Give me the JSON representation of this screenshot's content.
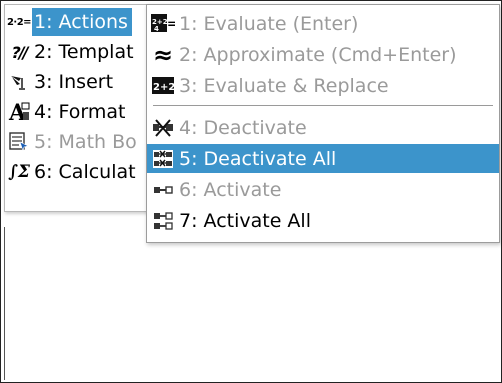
{
  "main_menu": {
    "items": [
      {
        "label": "1: Actions",
        "icon": "actions-icon",
        "state": "active"
      },
      {
        "label": "2: Templat",
        "icon": "templates-icon",
        "state": "normal"
      },
      {
        "label": "3: Insert",
        "icon": "insert-icon",
        "state": "normal"
      },
      {
        "label": "4: Format",
        "icon": "format-icon",
        "state": "normal"
      },
      {
        "label": "5: Math Bo",
        "icon": "math-boxes-icon",
        "state": "disabled"
      },
      {
        "label": "6: Calculat",
        "icon": "calculus-icon",
        "state": "normal"
      }
    ]
  },
  "sub_menu": {
    "items": [
      {
        "label": "1: Evaluate (Enter)",
        "icon": "evaluate-icon",
        "state": "disabled"
      },
      {
        "label": "2: Approximate (Cmd+Enter)",
        "icon": "approximate-icon",
        "state": "disabled"
      },
      {
        "label": "3: Evaluate & Replace",
        "icon": "evaluate-replace-icon",
        "state": "disabled"
      },
      {
        "label": "4: Deactivate",
        "icon": "deactivate-icon",
        "state": "disabled"
      },
      {
        "label": "5: Deactivate All",
        "icon": "deactivate-all-icon",
        "state": "highlighted"
      },
      {
        "label": "6: Activate",
        "icon": "activate-icon",
        "state": "disabled"
      },
      {
        "label": "7: Activate All",
        "icon": "activate-all-icon",
        "state": "normal"
      }
    ]
  },
  "icon_glyphs": {
    "actions": "2·2=",
    "templates": "?//",
    "format": "A",
    "calculus": "∫Σ",
    "evaluate": "2+2",
    "approximate": "≈",
    "evaluate_replace": "2+2"
  },
  "colors": {
    "highlight": "#3c94cb",
    "disabled_text": "#9a9a9a",
    "text": "#000000"
  }
}
